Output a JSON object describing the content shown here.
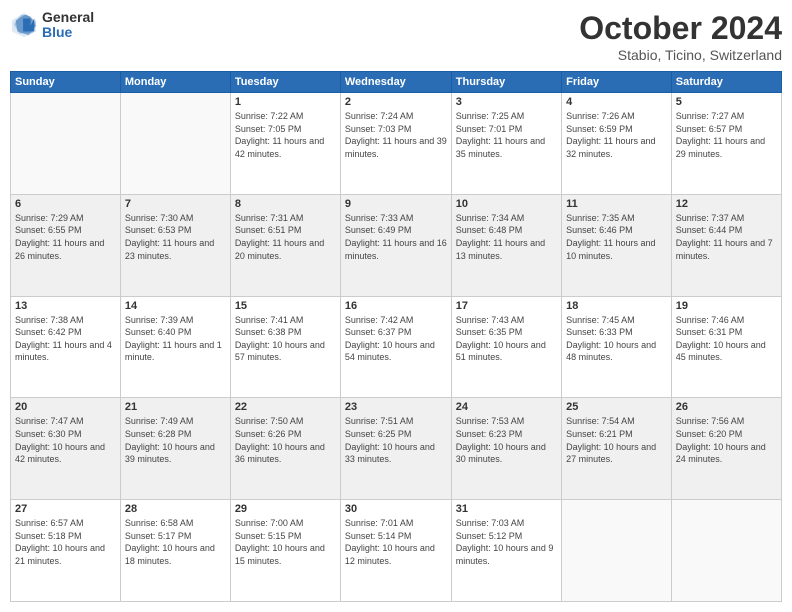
{
  "logo": {
    "general": "General",
    "blue": "Blue"
  },
  "header": {
    "month": "October 2024",
    "location": "Stabio, Ticino, Switzerland"
  },
  "weekdays": [
    "Sunday",
    "Monday",
    "Tuesday",
    "Wednesday",
    "Thursday",
    "Friday",
    "Saturday"
  ],
  "weeks": [
    [
      {
        "day": "",
        "info": ""
      },
      {
        "day": "",
        "info": ""
      },
      {
        "day": "1",
        "info": "Sunrise: 7:22 AM\nSunset: 7:05 PM\nDaylight: 11 hours and 42 minutes."
      },
      {
        "day": "2",
        "info": "Sunrise: 7:24 AM\nSunset: 7:03 PM\nDaylight: 11 hours and 39 minutes."
      },
      {
        "day": "3",
        "info": "Sunrise: 7:25 AM\nSunset: 7:01 PM\nDaylight: 11 hours and 35 minutes."
      },
      {
        "day": "4",
        "info": "Sunrise: 7:26 AM\nSunset: 6:59 PM\nDaylight: 11 hours and 32 minutes."
      },
      {
        "day": "5",
        "info": "Sunrise: 7:27 AM\nSunset: 6:57 PM\nDaylight: 11 hours and 29 minutes."
      }
    ],
    [
      {
        "day": "6",
        "info": "Sunrise: 7:29 AM\nSunset: 6:55 PM\nDaylight: 11 hours and 26 minutes."
      },
      {
        "day": "7",
        "info": "Sunrise: 7:30 AM\nSunset: 6:53 PM\nDaylight: 11 hours and 23 minutes."
      },
      {
        "day": "8",
        "info": "Sunrise: 7:31 AM\nSunset: 6:51 PM\nDaylight: 11 hours and 20 minutes."
      },
      {
        "day": "9",
        "info": "Sunrise: 7:33 AM\nSunset: 6:49 PM\nDaylight: 11 hours and 16 minutes."
      },
      {
        "day": "10",
        "info": "Sunrise: 7:34 AM\nSunset: 6:48 PM\nDaylight: 11 hours and 13 minutes."
      },
      {
        "day": "11",
        "info": "Sunrise: 7:35 AM\nSunset: 6:46 PM\nDaylight: 11 hours and 10 minutes."
      },
      {
        "day": "12",
        "info": "Sunrise: 7:37 AM\nSunset: 6:44 PM\nDaylight: 11 hours and 7 minutes."
      }
    ],
    [
      {
        "day": "13",
        "info": "Sunrise: 7:38 AM\nSunset: 6:42 PM\nDaylight: 11 hours and 4 minutes."
      },
      {
        "day": "14",
        "info": "Sunrise: 7:39 AM\nSunset: 6:40 PM\nDaylight: 11 hours and 1 minute."
      },
      {
        "day": "15",
        "info": "Sunrise: 7:41 AM\nSunset: 6:38 PM\nDaylight: 10 hours and 57 minutes."
      },
      {
        "day": "16",
        "info": "Sunrise: 7:42 AM\nSunset: 6:37 PM\nDaylight: 10 hours and 54 minutes."
      },
      {
        "day": "17",
        "info": "Sunrise: 7:43 AM\nSunset: 6:35 PM\nDaylight: 10 hours and 51 minutes."
      },
      {
        "day": "18",
        "info": "Sunrise: 7:45 AM\nSunset: 6:33 PM\nDaylight: 10 hours and 48 minutes."
      },
      {
        "day": "19",
        "info": "Sunrise: 7:46 AM\nSunset: 6:31 PM\nDaylight: 10 hours and 45 minutes."
      }
    ],
    [
      {
        "day": "20",
        "info": "Sunrise: 7:47 AM\nSunset: 6:30 PM\nDaylight: 10 hours and 42 minutes."
      },
      {
        "day": "21",
        "info": "Sunrise: 7:49 AM\nSunset: 6:28 PM\nDaylight: 10 hours and 39 minutes."
      },
      {
        "day": "22",
        "info": "Sunrise: 7:50 AM\nSunset: 6:26 PM\nDaylight: 10 hours and 36 minutes."
      },
      {
        "day": "23",
        "info": "Sunrise: 7:51 AM\nSunset: 6:25 PM\nDaylight: 10 hours and 33 minutes."
      },
      {
        "day": "24",
        "info": "Sunrise: 7:53 AM\nSunset: 6:23 PM\nDaylight: 10 hours and 30 minutes."
      },
      {
        "day": "25",
        "info": "Sunrise: 7:54 AM\nSunset: 6:21 PM\nDaylight: 10 hours and 27 minutes."
      },
      {
        "day": "26",
        "info": "Sunrise: 7:56 AM\nSunset: 6:20 PM\nDaylight: 10 hours and 24 minutes."
      }
    ],
    [
      {
        "day": "27",
        "info": "Sunrise: 6:57 AM\nSunset: 5:18 PM\nDaylight: 10 hours and 21 minutes."
      },
      {
        "day": "28",
        "info": "Sunrise: 6:58 AM\nSunset: 5:17 PM\nDaylight: 10 hours and 18 minutes."
      },
      {
        "day": "29",
        "info": "Sunrise: 7:00 AM\nSunset: 5:15 PM\nDaylight: 10 hours and 15 minutes."
      },
      {
        "day": "30",
        "info": "Sunrise: 7:01 AM\nSunset: 5:14 PM\nDaylight: 10 hours and 12 minutes."
      },
      {
        "day": "31",
        "info": "Sunrise: 7:03 AM\nSunset: 5:12 PM\nDaylight: 10 hours and 9 minutes."
      },
      {
        "day": "",
        "info": ""
      },
      {
        "day": "",
        "info": ""
      }
    ]
  ]
}
